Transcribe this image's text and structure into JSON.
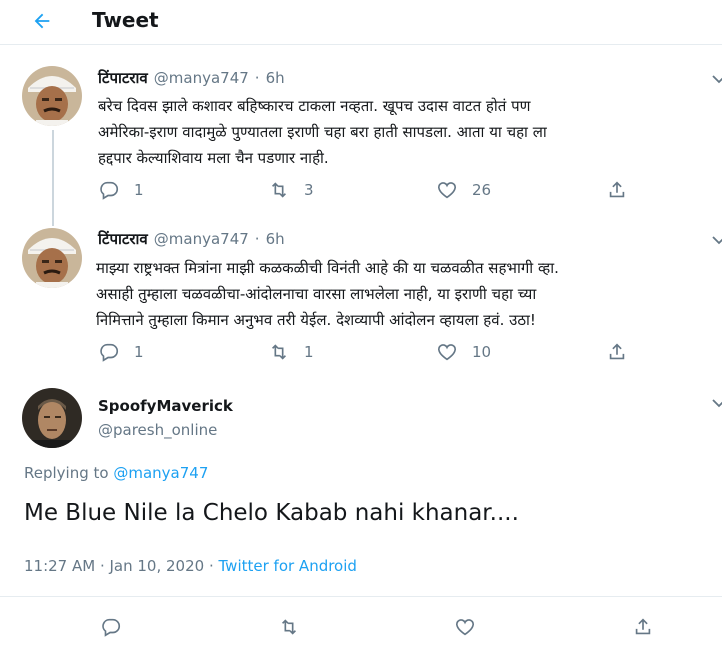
{
  "header": {
    "title": "Tweet"
  },
  "tweets": [
    {
      "name": "टिंपाटराव",
      "handle": "@manya747",
      "sep": "·",
      "time": "6h",
      "lines": [
        "बरेच दिवस झाले कशावर बहिष्कारच टाकला नव्हता. खूपच उदास वाटत होतं पण",
        "अमेरिका-इराण वादामुळे पुण्यातला इराणी चहा बरा हाती सापडला. आता या चहा ला",
        "हद्दपार केल्याशिवाय मला चैन पडणार नाही."
      ],
      "replies": "1",
      "retweets": "3",
      "likes": "26"
    },
    {
      "name": "टिंपाटराव",
      "handle": "@manya747",
      "sep": "·",
      "time": "6h",
      "lines": [
        "माझ्या राष्ट्रभक्त मित्रांना माझी कळकळीची विनंती आहे की या चळवळीत सहभागी व्हा.",
        "असाही तुम्हाला चळवळीचा-आंदोलनाचा वारसा लाभलेला नाही, या इराणी चहा च्या",
        "निमित्ताने तुम्हाला किमान अनुभव तरी येईल. देशव्यापी आंदोलन व्हायला हवं. उठा!"
      ],
      "replies": "1",
      "retweets": "1",
      "likes": "10"
    }
  ],
  "main_tweet": {
    "name": "SpoofyMaverick",
    "handle": "@paresh_online",
    "replying_label": "Replying to",
    "replying_to": "@manya747",
    "text": "Me Blue Nile la Chelo Kabab nahi khanar....",
    "timestamp": "11:27 AM · Jan 10, 2020 · ",
    "source": "Twitter for Android"
  },
  "icons": {
    "back": "arrow-left-icon",
    "reply": "reply-icon",
    "retweet": "retweet-icon",
    "like": "heart-icon",
    "share": "share-icon",
    "more": "chevron-down-icon"
  },
  "colors": {
    "accent": "#1da1f2",
    "secondary_text": "#657786",
    "primary_text": "#14171a"
  }
}
